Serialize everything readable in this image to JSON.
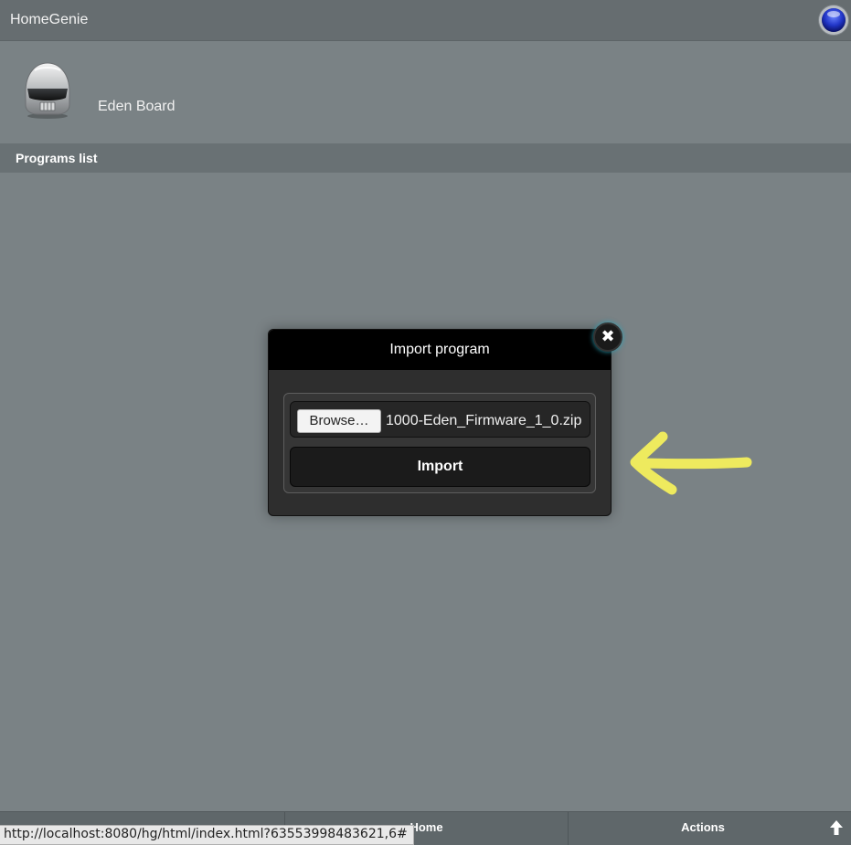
{
  "app": {
    "title": "HomeGenie",
    "status_icon": "status-orb-icon"
  },
  "header": {
    "device_name": "Eden Board",
    "avatar_icon": "robot-helmet-icon"
  },
  "section": {
    "title": "Programs list"
  },
  "dialog": {
    "title": "Import program",
    "close_icon": "close-icon",
    "browse_label": "Browse…",
    "file_name": "1000-Eden_Firmware_1_0.zip",
    "import_label": "Import"
  },
  "annotation": {
    "arrow_color": "#f4ef5c"
  },
  "bottombar": {
    "tabs": [
      {
        "label": "Home"
      },
      {
        "label": "Actions"
      }
    ],
    "up_icon": "up-arrow-icon"
  },
  "statusbar": {
    "url": "http://localhost:8080/hg/html/index.html?63553998483621,6#"
  },
  "colors": {
    "background": "#7a8285",
    "topbar": "#666d70",
    "dialog_header": "#000000",
    "accent_glow": "#2aa3b8"
  }
}
